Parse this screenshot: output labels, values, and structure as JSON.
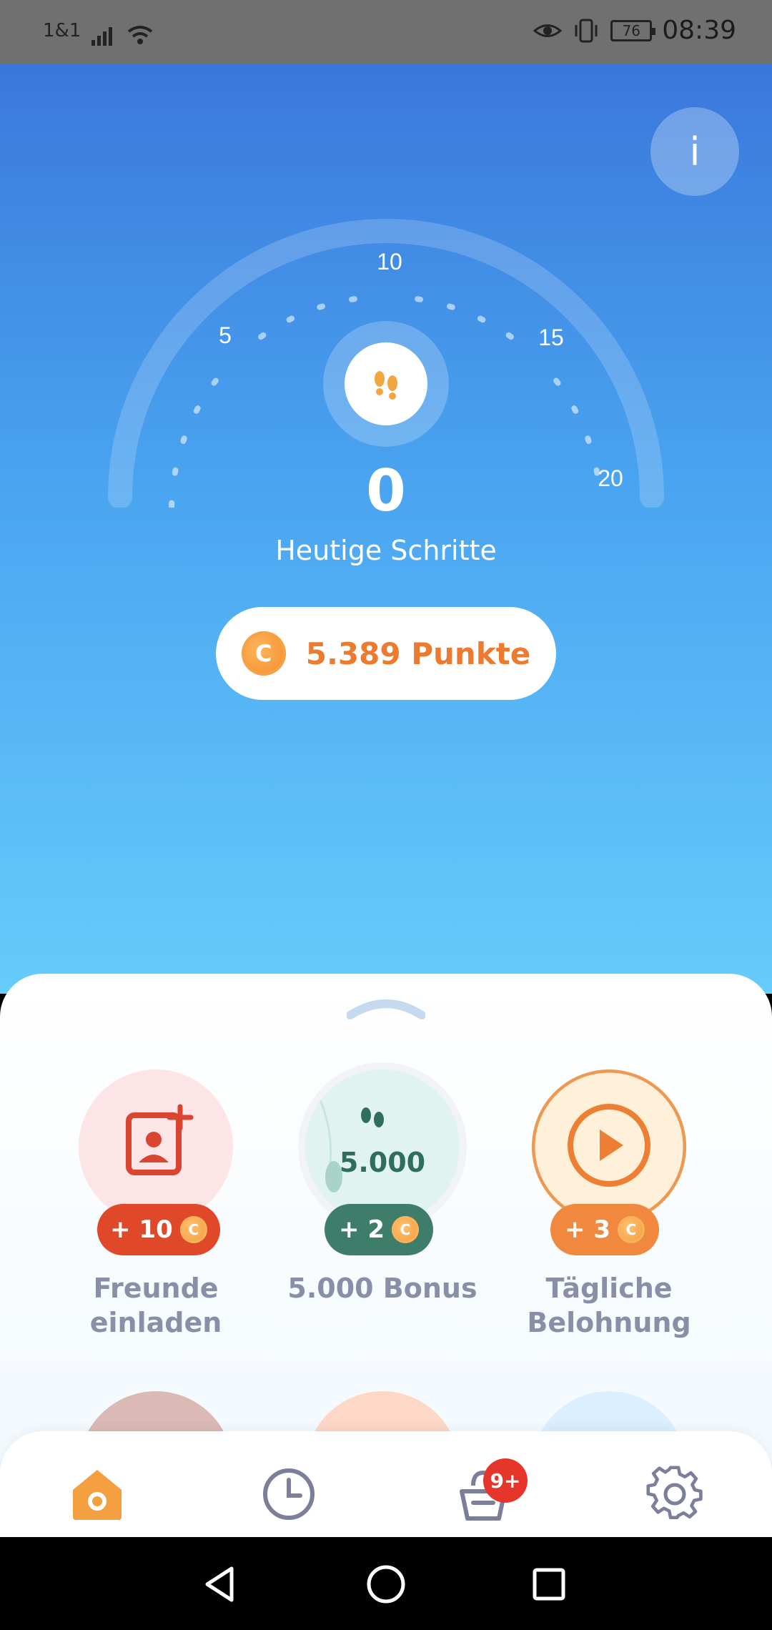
{
  "status_bar": {
    "carrier": "1&1",
    "battery": "76",
    "time": "08:39"
  },
  "info_button": {
    "label": "i"
  },
  "gauge": {
    "ticks": [
      "5",
      "10",
      "15",
      "20"
    ],
    "level": 0
  },
  "steps": {
    "value": "0",
    "label": "Heutige Schritte"
  },
  "points": {
    "coin_symbol": "C",
    "label": "5.389 Punkte"
  },
  "tasks": [
    {
      "name": "invite",
      "badge": "+ 10",
      "label_line1": "Freunde",
      "label_line2": "einladen",
      "badge_color": "#e0482a"
    },
    {
      "name": "bonus",
      "badge": "+ 2",
      "label_line1": "5.000 Bonus",
      "label_line2": "",
      "inner_value": "5.000",
      "badge_color": "#3f7d6b"
    },
    {
      "name": "daily",
      "badge": "+ 3",
      "label_line1": "Tägliche",
      "label_line2": "Belohnung",
      "badge_color": "#f0883d"
    }
  ],
  "tabbar": {
    "notification_count": "9+",
    "active_tab": "home"
  },
  "colors": {
    "accent_orange": "#f4a040",
    "points_text": "#ec7a2f",
    "tab_icon": "#7b7f9a"
  },
  "icons": [
    "eye-icon",
    "vibrate-icon",
    "wifi-icon",
    "signal-icon",
    "footprints-icon",
    "coin-icon",
    "add-contact-icon",
    "play-icon",
    "home-icon",
    "clock-icon",
    "shopping-icon",
    "gear-icon",
    "back-icon",
    "home-circle-icon",
    "recents-icon"
  ]
}
